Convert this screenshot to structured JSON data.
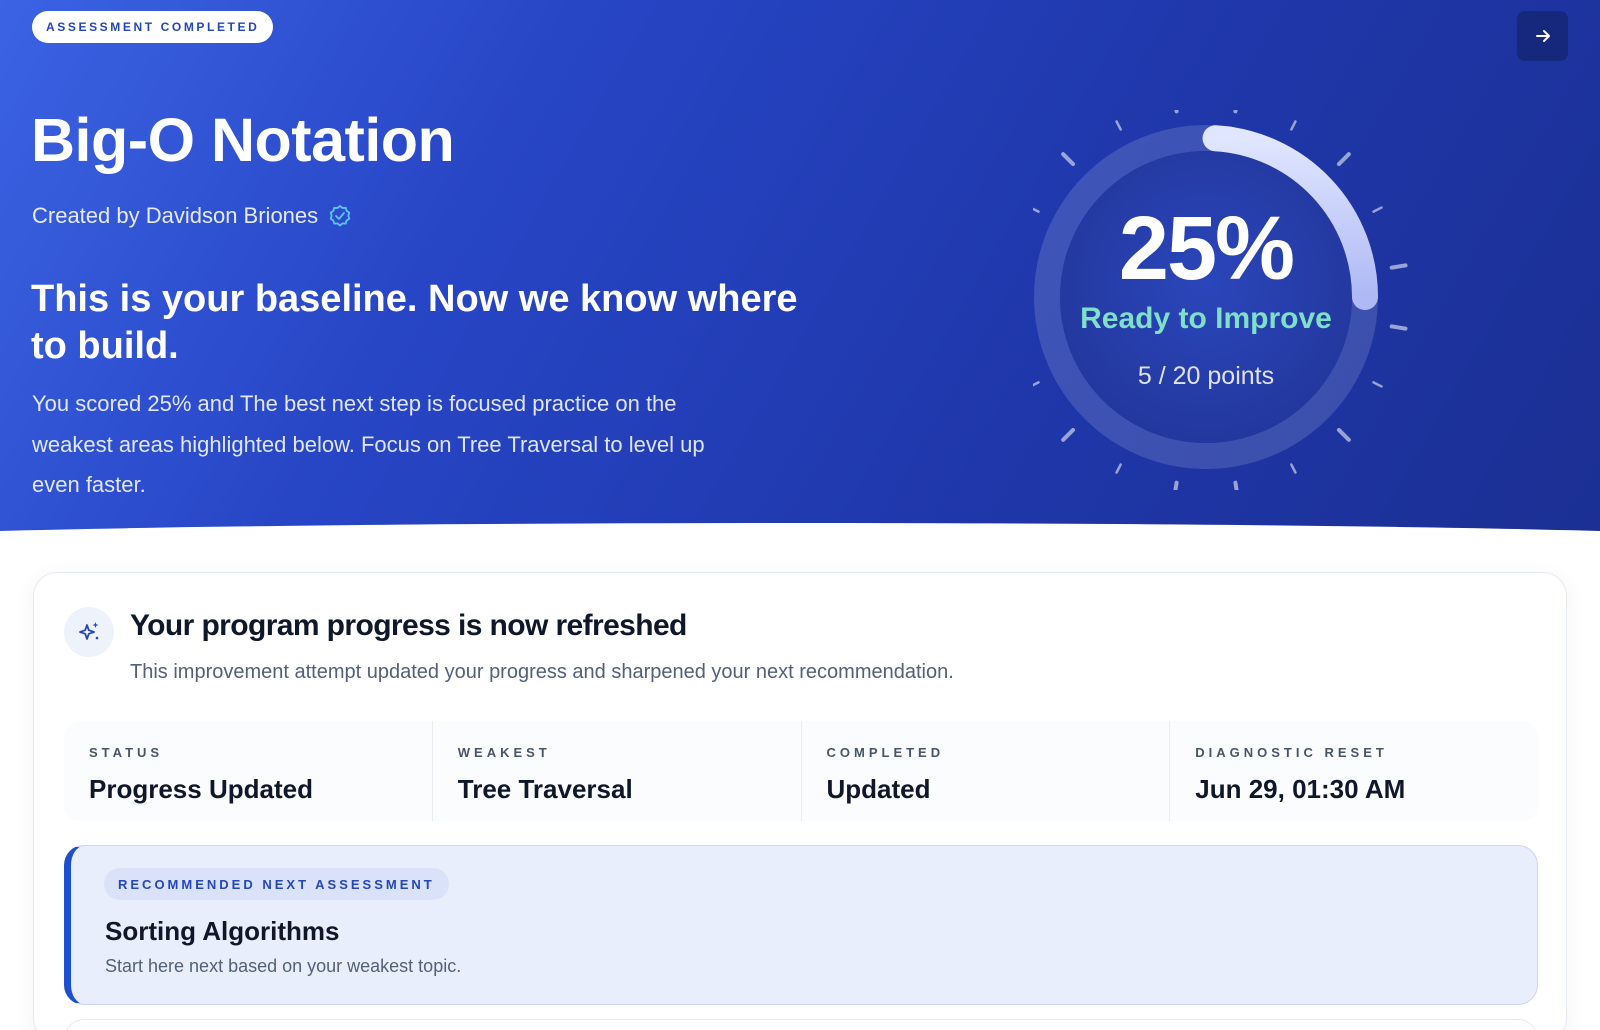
{
  "hero": {
    "badge": "ASSESSMENT COMPLETED",
    "title": "Big-O Notation",
    "creator": "Created by Davidson Briones",
    "headline": "This is your baseline. Now we know where to build.",
    "description": "You scored 25% and The best next step is focused practice on the weakest areas highlighted below. Focus on Tree Traversal to level up even faster.",
    "next_icon": "arrow-right-icon",
    "verified_icon": "verified-check-icon"
  },
  "score": {
    "percent_label": "25%",
    "fraction": 0.25,
    "status": "Ready to Improve",
    "points": "5 / 20 points",
    "status_color": "#7ee0c8"
  },
  "progress_card": {
    "icon": "sparkles-icon",
    "title": "Your program progress is now refreshed",
    "subtitle": "This improvement attempt updated your progress and sharpened your next recommendation."
  },
  "stats": [
    {
      "label": "STATUS",
      "value": "Progress Updated"
    },
    {
      "label": "WEAKEST",
      "value": "Tree Traversal"
    },
    {
      "label": "COMPLETED",
      "value": "Updated"
    },
    {
      "label": "DIAGNOSTIC RESET",
      "value": "Jun 29, 01:30 AM"
    }
  ],
  "recommendation": {
    "badge": "RECOMMENDED NEXT ASSESSMENT",
    "title": "Sorting Algorithms",
    "subtitle": "Start here next based on your weakest topic.",
    "accent": "#1f4fd1"
  },
  "colors": {
    "hero_start": "#3b63e3",
    "hero_end": "#1b2f93",
    "accent": "#2446b8"
  }
}
